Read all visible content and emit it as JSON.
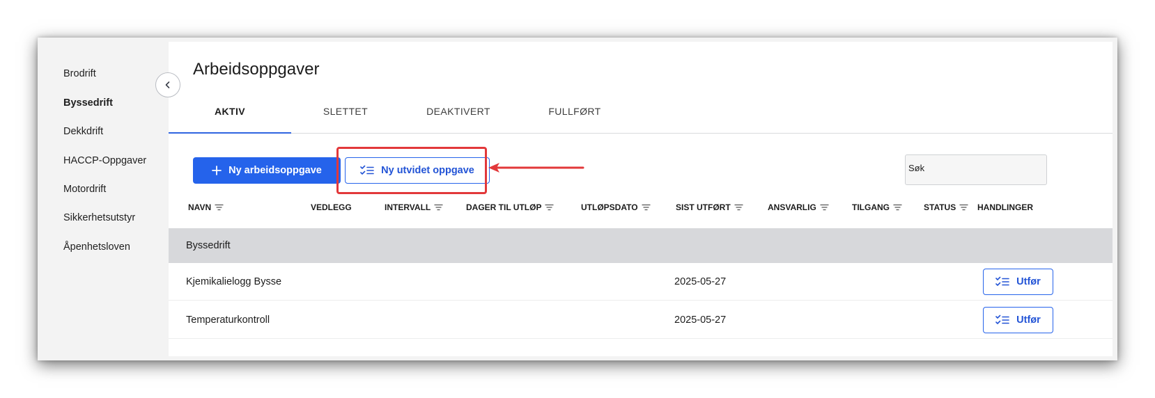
{
  "sidebar": {
    "items": [
      {
        "label": "Brodrift"
      },
      {
        "label": "Byssedrift"
      },
      {
        "label": "Dekkdrift"
      },
      {
        "label": "HACCP-Oppgaver"
      },
      {
        "label": "Motordrift"
      },
      {
        "label": "Sikkerhetsutstyr"
      },
      {
        "label": "Åpenhetsloven"
      }
    ],
    "active_item": "Byssedrift"
  },
  "main": {
    "title": "Arbeidsoppgaver",
    "tabs": [
      {
        "label": "AKTIV"
      },
      {
        "label": "SLETTET"
      },
      {
        "label": "DEAKTIVERT"
      },
      {
        "label": "FULLFØRT"
      }
    ],
    "active_tab": "AKTIV",
    "new_task_button": "Ny arbeidsoppgave",
    "new_extended_task_button": "Ny utvidet oppgave",
    "search": {
      "value": "Søk"
    }
  },
  "table": {
    "columns": [
      {
        "label": "NAVN"
      },
      {
        "label": "VEDLEGG"
      },
      {
        "label": "INTERVALL"
      },
      {
        "label": "DAGER TIL UTLØP"
      },
      {
        "label": "UTLØPSDATO"
      },
      {
        "label": "SIST UTFØRT"
      },
      {
        "label": "ANSVARLIG"
      },
      {
        "label": "TILGANG"
      },
      {
        "label": "STATUS"
      },
      {
        "label": "HANDLINGER"
      }
    ],
    "group": "Byssedrift",
    "rows": [
      {
        "name": "Kjemikalielogg Bysse",
        "last_done": "2025-05-27",
        "action": "Utfør"
      },
      {
        "name": "Temperaturkontroll",
        "last_done": "2025-05-27",
        "action": "Utfør"
      }
    ]
  },
  "icons": {
    "collapse": "chevron-left-icon",
    "plus": "plus-icon",
    "checklist": "checklist-icon",
    "filter": "filter-sort-icon"
  },
  "colors": {
    "accent": "#2563eb",
    "highlight": "#e2383a",
    "group_row": "#d7d8db"
  }
}
